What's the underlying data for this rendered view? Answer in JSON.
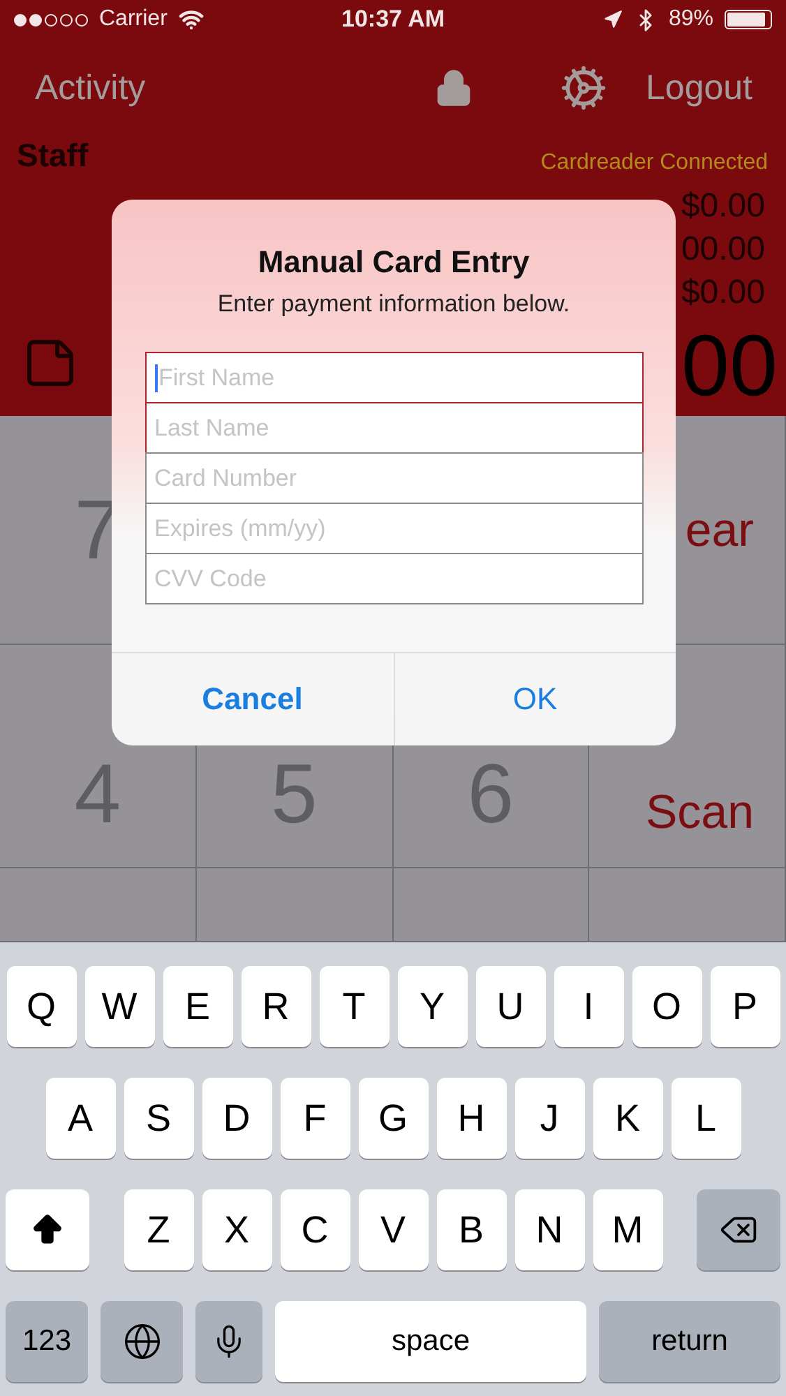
{
  "status_bar": {
    "carrier": "Carrier",
    "time": "10:37 AM",
    "battery": "89%"
  },
  "nav": {
    "left": "Activity",
    "right": "Logout"
  },
  "staff_label": "Staff",
  "reader_status": "Cardreader Connected",
  "amounts": [
    "$0.00",
    "00.00",
    "$0.00"
  ],
  "total": "00",
  "keypad": [
    [
      {
        "label": "7",
        "kind": "digit"
      },
      {
        "label": "ear",
        "kind": "action"
      }
    ],
    [
      {
        "label": "4",
        "kind": "digit"
      },
      {
        "label": "5",
        "kind": "digit"
      },
      {
        "label": "6",
        "kind": "digit"
      },
      {
        "label": "Scan",
        "kind": "action"
      }
    ]
  ],
  "dialog": {
    "title": "Manual Card Entry",
    "message": "Enter payment information below.",
    "fields": [
      {
        "placeholder": "First Name",
        "focused": true,
        "color": "#a8262c"
      },
      {
        "placeholder": "Last Name",
        "focused": false,
        "color": "#a8262c"
      },
      {
        "placeholder": "Card Number",
        "focused": false,
        "color": "#8a8a8a"
      },
      {
        "placeholder": "Expires (mm/yy)",
        "focused": false,
        "color": "#8a8a8a"
      },
      {
        "placeholder": "CVV Code",
        "focused": false,
        "color": "#8a8a8a"
      }
    ],
    "buttons": [
      {
        "label": "Cancel",
        "kind": "cancel"
      },
      {
        "label": "OK",
        "kind": "default"
      }
    ]
  },
  "keyboard": [
    [
      {
        "kind": "letter",
        "label": "Q"
      },
      {
        "kind": "letter",
        "label": "W"
      },
      {
        "kind": "letter",
        "label": "E"
      },
      {
        "kind": "letter",
        "label": "R"
      },
      {
        "kind": "letter",
        "label": "T"
      },
      {
        "kind": "letter",
        "label": "Y"
      },
      {
        "kind": "letter",
        "label": "U"
      },
      {
        "kind": "letter",
        "label": "I"
      },
      {
        "kind": "letter",
        "label": "O"
      },
      {
        "kind": "letter",
        "label": "P"
      }
    ],
    [
      {
        "kind": "letter",
        "label": "A"
      },
      {
        "kind": "letter",
        "label": "S"
      },
      {
        "kind": "letter",
        "label": "D"
      },
      {
        "kind": "letter",
        "label": "F"
      },
      {
        "kind": "letter",
        "label": "G"
      },
      {
        "kind": "letter",
        "label": "H"
      },
      {
        "kind": "letter",
        "label": "J"
      },
      {
        "kind": "letter",
        "label": "K"
      },
      {
        "kind": "letter",
        "label": "L"
      }
    ],
    [
      {
        "kind": "shift"
      },
      {
        "kind": "letter",
        "label": "Z"
      },
      {
        "kind": "letter",
        "label": "X"
      },
      {
        "kind": "letter",
        "label": "C"
      },
      {
        "kind": "letter",
        "label": "V"
      },
      {
        "kind": "letter",
        "label": "B"
      },
      {
        "kind": "letter",
        "label": "N"
      },
      {
        "kind": "letter",
        "label": "M"
      },
      {
        "kind": "delete"
      }
    ],
    [
      {
        "kind": "mode",
        "label": "123"
      },
      {
        "kind": "globe"
      },
      {
        "kind": "mic"
      },
      {
        "kind": "space",
        "label": "space"
      },
      {
        "kind": "return",
        "label": "return"
      }
    ]
  ]
}
